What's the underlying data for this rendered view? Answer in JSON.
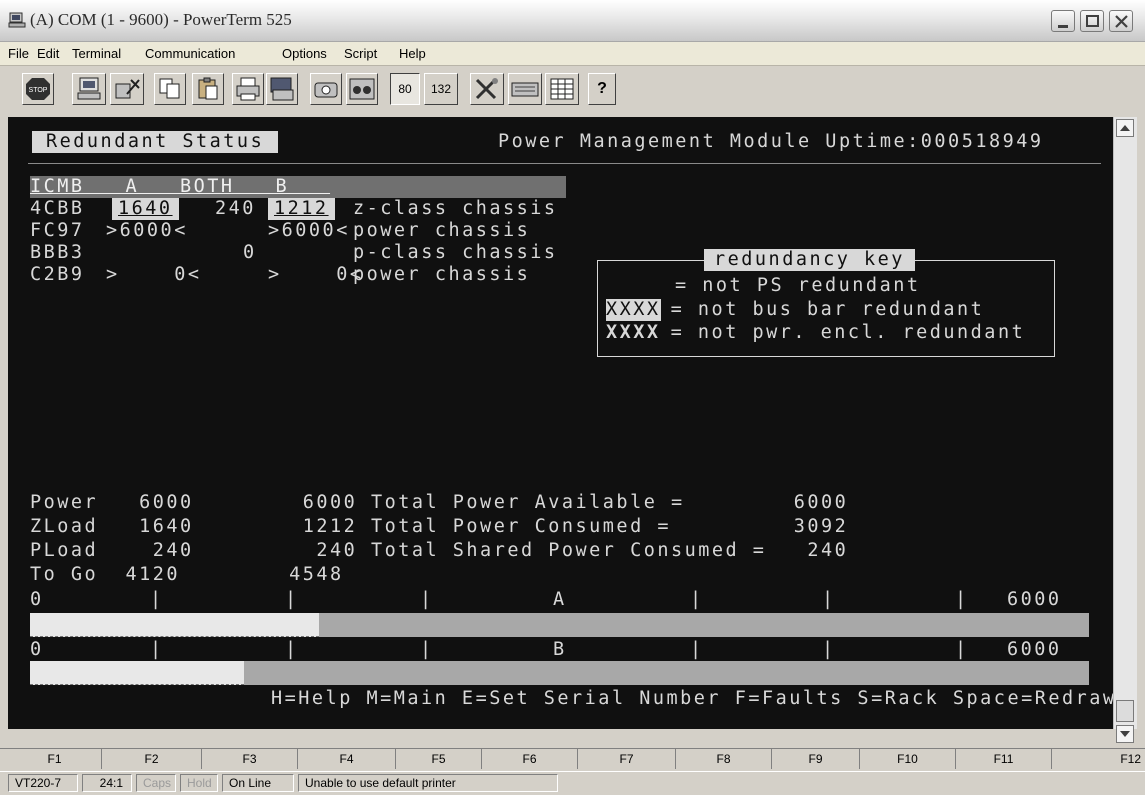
{
  "window": {
    "title": "(A) COM (1 - 9600) - PowerTerm 525"
  },
  "menu": [
    "File",
    "Edit",
    "Terminal",
    "Communication",
    "Options",
    "Script",
    "Help"
  ],
  "toolbar": {
    "buttons": [
      "stop-icon",
      "connect-icon",
      "disconnect-icon",
      "copy-icon",
      "paste-icon",
      "print-icon",
      "print-screen-icon",
      "dial-icon",
      "hangup-icon",
      "cols-80",
      "cols-132",
      "setup-icon",
      "keyboard-icon",
      "grid-icon",
      "help-icon"
    ],
    "stop_label": "STOP",
    "cols80_label": "80",
    "cols132_label": "132",
    "help_label": "?"
  },
  "screen": {
    "header_title": "Redundant Status",
    "uptime_label": "Power Management Module Uptime:000518949",
    "table_header": "ICMB   A   BOTH   B   ",
    "rows": [
      {
        "id": "4CBB",
        "a": "1640",
        "both": "240",
        "b": "1212",
        "desc": "z-class chassis"
      },
      {
        "id": "FC97",
        "a": ">6000<",
        "both": "",
        "b": ">6000<",
        "desc": "power chassis"
      },
      {
        "id": "BBB3",
        "a": "",
        "both": "0",
        "b": "",
        "desc": "p-class chassis"
      },
      {
        "id": "C2B9",
        "a": ">    0<",
        "both": "",
        "b": ">    0<",
        "desc": "power chassis"
      }
    ],
    "key": {
      "title": "redundancy key",
      "line1": "= not PS redundant",
      "line2_code": "XXXX",
      "line2_text": " = not bus bar redundant",
      "line3_code": "XXXX",
      "line3_text": " = not pwr. encl. redundant"
    },
    "summary": [
      "Power   6000        6000 Total Power Available =        6000",
      "ZLoad   1640        1212 Total Power Consumed =         3092",
      "PLoad    240         240 Total Shared Power Consumed =   240",
      "To Go  4120        4548"
    ],
    "scale_a": {
      "start": "0",
      "label": "A",
      "end": "6000",
      "fill": 0.2733
    },
    "scale_b": {
      "start": "0",
      "label": "B",
      "end": "6000",
      "fill": 0.202
    },
    "help_line": "H=Help M=Main E=Set Serial Number F=Faults S=Rack Space=Redraw"
  },
  "fkeys": [
    "F1",
    "F2",
    "F3",
    "F4",
    "F5",
    "F6",
    "F7",
    "F8",
    "F9",
    "F10",
    "F11",
    "F12"
  ],
  "status": {
    "emulation": "VT220-7",
    "cursor": "24:1",
    "caps": "Caps",
    "hold": "Hold",
    "online": "On Line",
    "message": "Unable to use default printer"
  },
  "colors": {
    "terminal_bg": "#101010",
    "terminal_fg": "#d8d8d8",
    "bar_fill": "#e8e8e8",
    "bar_track": "#a8a8a8"
  }
}
